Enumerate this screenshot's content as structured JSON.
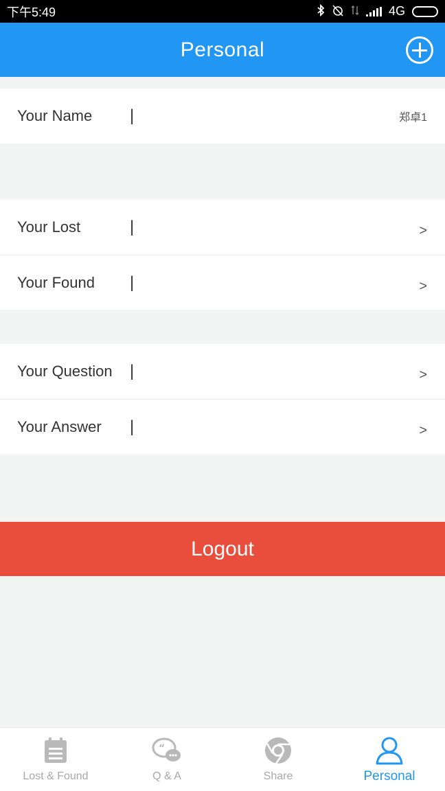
{
  "status_bar": {
    "time": "下午5:49",
    "network": "4G",
    "icons": [
      "bluetooth-icon",
      "alarm-off-icon",
      "data-transfer-icon",
      "signal-icon",
      "battery-icon"
    ]
  },
  "header": {
    "title": "Personal",
    "add_icon": "plus-circle-icon",
    "color": "#2196f3"
  },
  "profile": {
    "name_label": "Your Name",
    "separator": "|",
    "name_value": "郑卓1"
  },
  "menu": {
    "lost_label": "Your Lost",
    "found_label": "Your Found",
    "question_label": "Your Question",
    "answer_label": "Your Answer",
    "separator": "|",
    "arrow": ">"
  },
  "logout": {
    "label": "Logout",
    "color": "#e94e3d"
  },
  "bottom_nav": {
    "items": [
      {
        "label": "Lost & Found",
        "icon": "calendar-list-icon",
        "active": false
      },
      {
        "label": "Q & A",
        "icon": "chat-bubbles-icon",
        "active": false
      },
      {
        "label": "Share",
        "icon": "chrome-icon",
        "active": false
      },
      {
        "label": "Personal",
        "icon": "person-icon",
        "active": true
      }
    ]
  }
}
